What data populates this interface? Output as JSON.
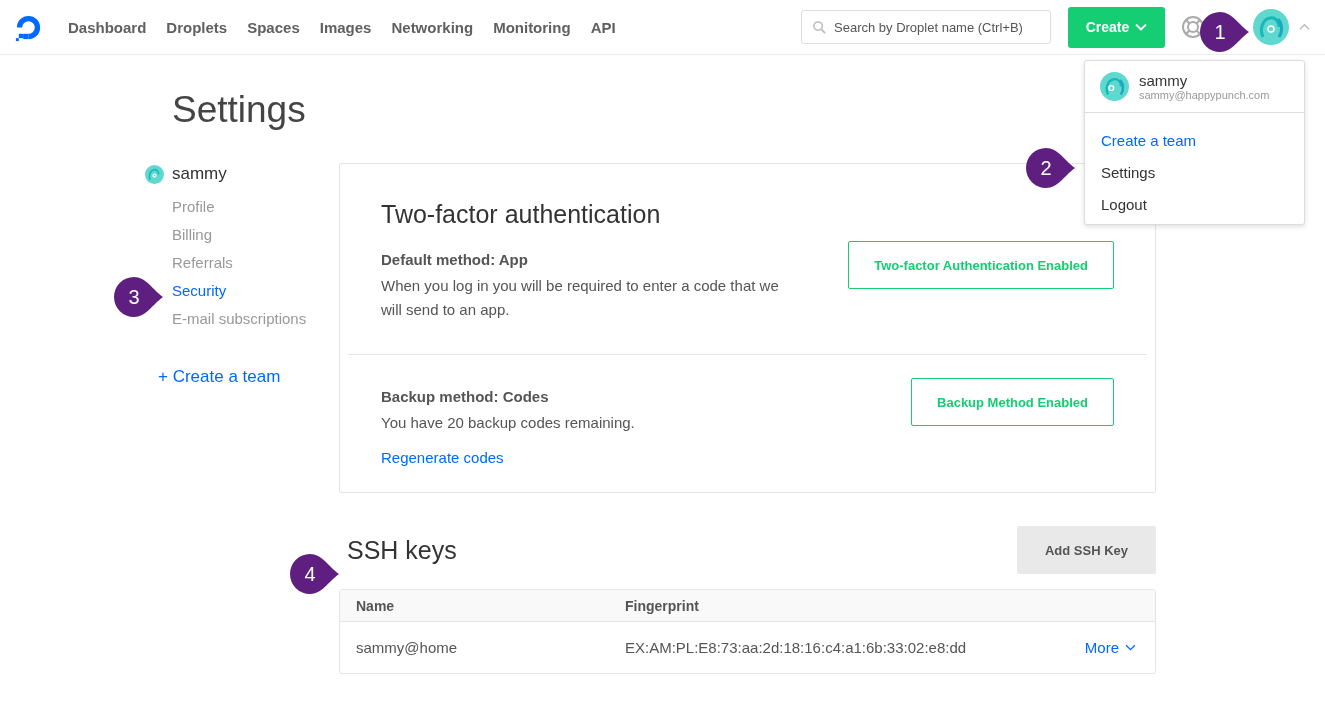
{
  "nav": {
    "items": [
      "Dashboard",
      "Droplets",
      "Spaces",
      "Images",
      "Networking",
      "Monitoring",
      "API"
    ],
    "search": {
      "placeholder": "Search by Droplet name (Ctrl+B)"
    },
    "create_button": "Create"
  },
  "user_menu": {
    "name": "sammy",
    "email": "sammy@happypunch.com",
    "items": [
      {
        "label": "Create a team",
        "kind": "link"
      },
      {
        "label": "Settings",
        "kind": "item"
      },
      {
        "label": "Logout",
        "kind": "item"
      }
    ]
  },
  "page_title": "Settings",
  "sidebar": {
    "user": "sammy",
    "items": [
      {
        "label": "Profile",
        "selected": false
      },
      {
        "label": "Billing",
        "selected": false
      },
      {
        "label": "Referrals",
        "selected": false
      },
      {
        "label": "Security",
        "selected": true
      },
      {
        "label": "E-mail subscriptions",
        "selected": false
      }
    ],
    "create_team": "+ Create a team"
  },
  "two_factor": {
    "title": "Two-factor authentication",
    "sections": [
      {
        "heading": "Default method: App",
        "text": "When you log in you will be required to enter a code that we will send to an app.",
        "button": "Two-factor Authentication Enabled"
      },
      {
        "heading": "Backup method: Codes",
        "text": "You have 20 backup codes remaining.",
        "link": "Regenerate codes",
        "button": "Backup Method Enabled"
      }
    ]
  },
  "ssh_keys": {
    "title": "SSH keys",
    "add_button": "Add SSH Key",
    "columns": [
      "Name",
      "Fingerprint"
    ],
    "rows": [
      {
        "name": "sammy@home",
        "fingerprint": "EX:AM:PL:E8:73:aa:2d:18:16:c4:a1:6b:33:02:e8:dd",
        "action": "More"
      }
    ]
  },
  "callouts": [
    "1",
    "2",
    "3",
    "4"
  ]
}
